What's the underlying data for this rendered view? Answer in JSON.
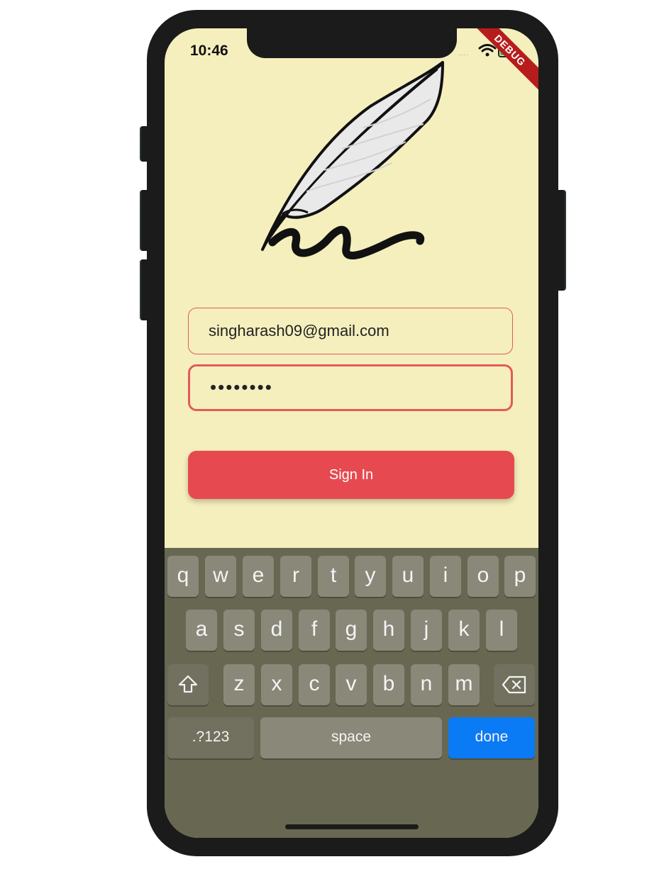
{
  "status_bar": {
    "time": "10:46",
    "signal": "....",
    "debug_banner": "DEBUG"
  },
  "logo": {
    "icon": "quill-feather-icon"
  },
  "form": {
    "email_value": "singharash09@gmail.com",
    "password_value": "••••••••",
    "signin_label": "Sign In"
  },
  "colors": {
    "background": "#f5efbd",
    "accent": "#e64a50",
    "keyboard": "#686752",
    "done": "#0a7af5"
  },
  "keyboard": {
    "row1": [
      "q",
      "w",
      "e",
      "r",
      "t",
      "y",
      "u",
      "i",
      "o",
      "p"
    ],
    "row2": [
      "a",
      "s",
      "d",
      "f",
      "g",
      "h",
      "j",
      "k",
      "l"
    ],
    "row3": [
      "z",
      "x",
      "c",
      "v",
      "b",
      "n",
      "m"
    ],
    "numbers_label": ".?123",
    "space_label": "space",
    "done_label": "done"
  }
}
